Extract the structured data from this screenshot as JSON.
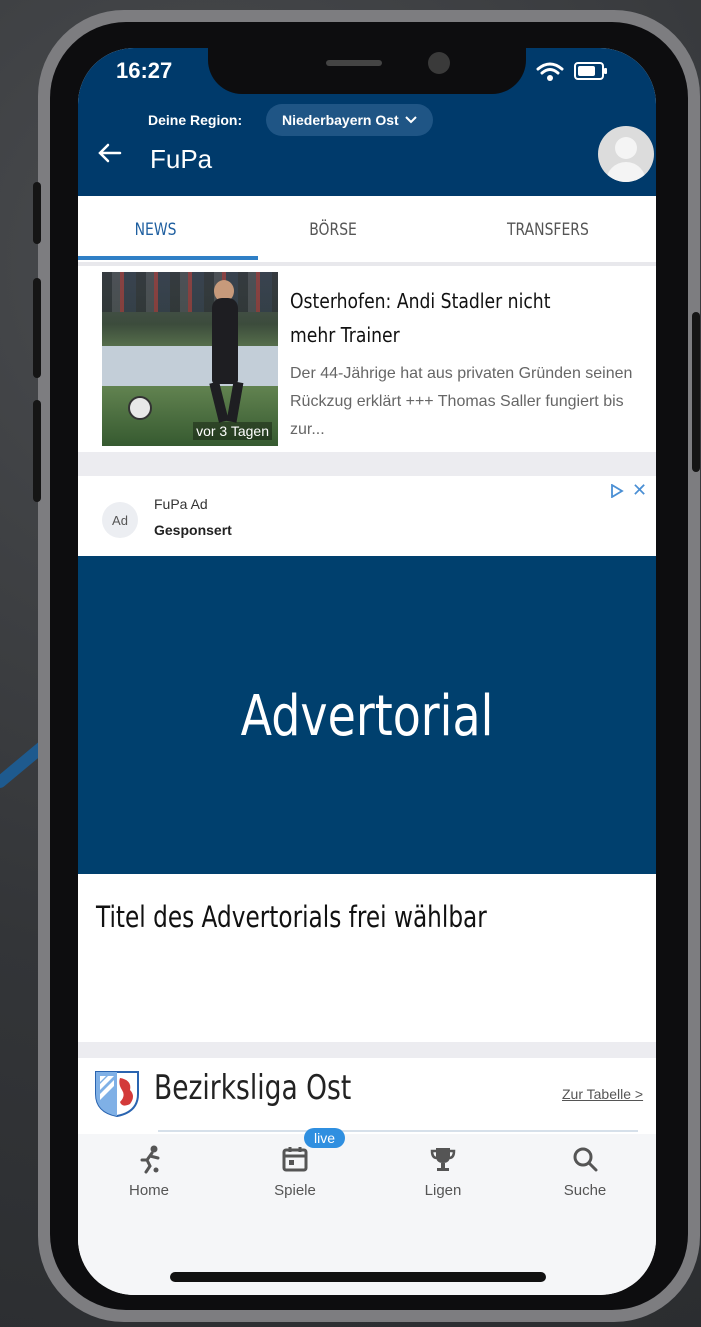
{
  "status_bar": {
    "time": "16:27"
  },
  "header": {
    "region_label": "Deine Region:",
    "region_value": "Niederbayern Ost",
    "title": "FuPa"
  },
  "tabs": [
    {
      "label": "NEWS",
      "active": true
    },
    {
      "label": "BÖRSE",
      "active": false
    },
    {
      "label": "TRANSFERS",
      "active": false
    }
  ],
  "article": {
    "title": "Osterhofen: Andi Stadler nicht mehr Trainer",
    "teaser": "Der 44-Jährige hat aus privaten Gründen seinen Rückzug erklärt +++ Thomas Saller fungiert bis zur...",
    "time_tag": "vor 3 Tagen"
  },
  "ad": {
    "badge": "Ad",
    "name": "FuPa Ad",
    "sponsored": "Gesponsert",
    "close": "✕"
  },
  "advertorial": {
    "banner_text": "Advertorial",
    "title": "Titel des Advertorials frei wählbar"
  },
  "league": {
    "name": "Bezirksliga Ost",
    "link": "Zur Tabelle >"
  },
  "bottom_nav": [
    {
      "label": "Home",
      "icon": "player-kick-icon"
    },
    {
      "label": "Spiele",
      "icon": "calendar-icon",
      "badge": "live"
    },
    {
      "label": "Ligen",
      "icon": "trophy-icon"
    },
    {
      "label": "Suche",
      "icon": "search-icon"
    }
  ],
  "colors": {
    "primary": "#003a6b",
    "advertorial_bg": "#00406e",
    "accent": "#2f7fc6",
    "live_badge": "#2f8fe0"
  }
}
